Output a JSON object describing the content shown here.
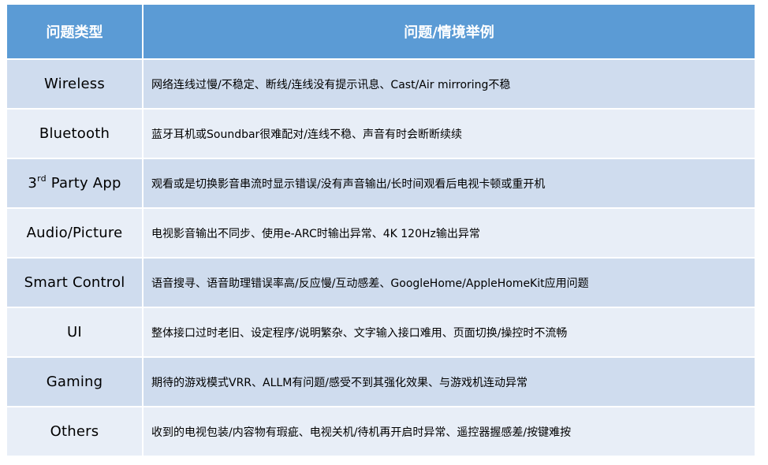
{
  "header": {
    "type_label": "问题类型",
    "example_label": "问题/情境举例"
  },
  "rows": [
    {
      "type": "Wireless",
      "example": "网络连线过慢/不稳定、断线/连线没有提示讯息、Cast/Air mirroring不稳"
    },
    {
      "type": "Bluetooth",
      "example": "蓝牙耳机或Soundbar很难配对/连线不稳、声音有时会断断续续"
    },
    {
      "type_prefix": "3",
      "type_sup": "rd",
      "type_suffix": " Party App",
      "example": "观看或是切换影音串流时显示错误/没有声音输出/长时间观看后电视卡顿或重开机"
    },
    {
      "type": "Audio/Picture",
      "example": "电视影音输出不同步、使用e-ARC时输出异常、4K 120Hz输出异常"
    },
    {
      "type": "Smart Control",
      "example": "语音搜寻、语音助理错误率高/反应慢/互动感差、GoogleHome/AppleHomeKit应用问题"
    },
    {
      "type": "UI",
      "example": "整体接口过时老旧、设定程序/说明繁杂、文字输入接口难用、页面切换/操控时不流畅"
    },
    {
      "type": "Gaming",
      "example": "期待的游戏模式VRR、ALLM有问题/感受不到其强化效果、与游戏机连动异常"
    },
    {
      "type": "Others",
      "example": "收到的电视包装/内容物有瑕疵、电视关机/待机再开启时异常、遥控器握感差/按键难按"
    }
  ],
  "colors": {
    "header_bg": "#5b9bd5",
    "row_odd_bg": "#cfdcee",
    "row_even_bg": "#e8eef7"
  }
}
